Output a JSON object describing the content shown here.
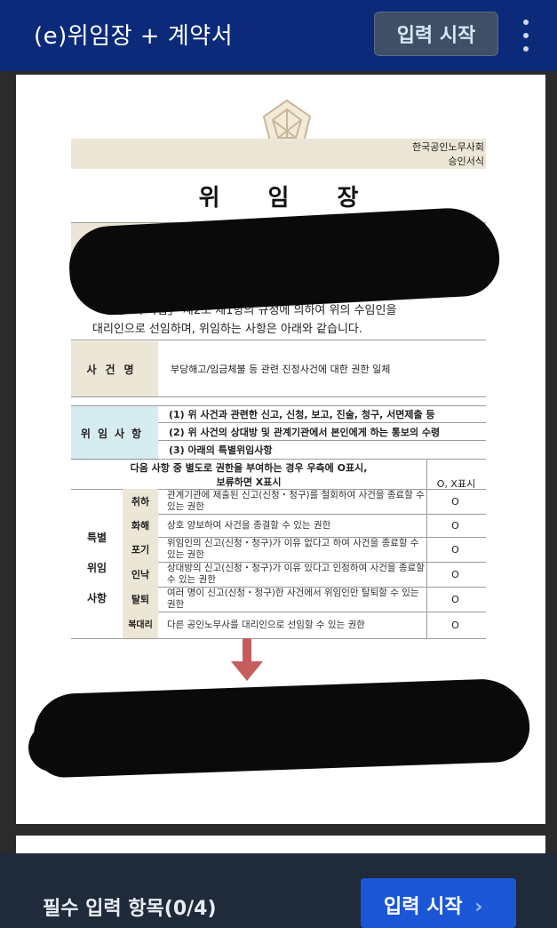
{
  "app_bar": {
    "title": "(e)위임장 + 계약서",
    "start_button": "입력 시작",
    "more_icon": "more-vert-icon"
  },
  "document": {
    "org_line1": "한국공인노무사회",
    "org_line2": "승인서식",
    "title": "위임장",
    "intro_line1": "「공인노무사법」 제2조 제1항의 규정에 의하여 위의 수임인을",
    "intro_line2": "대리인으로 선임하며, 위임하는 사항은 아래와 같습니다.",
    "case_label": "사건명",
    "case_value": "부당해고/임금체불 등 관련 진정사건에 대한 권한 일체",
    "delegation_label": "위임사항",
    "delegation_items": [
      "(1) 위 사건과 관련한 신고, 신청, 보고, 진술, 청구, 서면제출 등",
      "(2) 위 사건의 상대방 및 관계기관에서 본인에게 하는 통보의 수령",
      "(3) 아래의 특별위임사항"
    ],
    "special_header_line1": "다음 사항 중 별도로 권한을 부여하는 경우 우측에 O표시,",
    "special_header_line2": "보류하면 X표시",
    "ox_header": "O, X표시",
    "special_label": [
      "특별",
      "위임",
      "사항"
    ],
    "special_rows": [
      {
        "name": "취하",
        "desc": "관계기관에 제출된 신고(신청・청구)를 철회하여 사건을 종료할 수 있는 권한",
        "mark": "O"
      },
      {
        "name": "화해",
        "desc": "상호 양보하여 사건을 종결할 수 있는 권한",
        "mark": "O"
      },
      {
        "name": "포기",
        "desc": "위임인의 신고(신청・청구)가 이유 없다고 하여 사건을 종료할 수 있는 권한",
        "mark": "O"
      },
      {
        "name": "인낙",
        "desc": "상대방의 신고(신청・청구)가 이유 있다고 인정하여 사건을 종료할 수 있는 권한",
        "mark": "O"
      },
      {
        "name": "탈퇴",
        "desc": "여러 명이 신고(신청・청구)한 사건에서 위임인만 탈퇴할 수 있는 권한",
        "mark": "O"
      },
      {
        "name": "복대리",
        "desc": "다른 공인노무사를 대리인으로 선임할 수 있는 권한",
        "mark": "O"
      }
    ]
  },
  "bottom_bar": {
    "required_label": "필수 입력 항목(0/4)",
    "start_button": "입력 시작",
    "chevron_icon": "chevron-right-icon"
  },
  "colors": {
    "appbar": "#0b2a7a",
    "primary_button": "#1a56d6",
    "band_beige": "#ece6d6",
    "band_blue": "#d7ecf1"
  }
}
